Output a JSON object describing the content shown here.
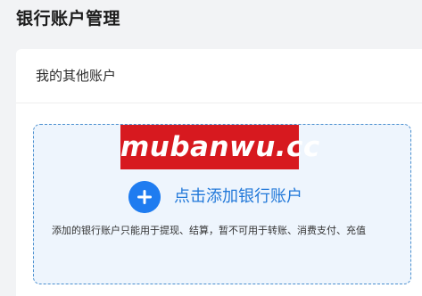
{
  "page": {
    "title": "银行账户管理"
  },
  "card": {
    "header_title": "我的其他账户"
  },
  "add_account": {
    "icon": "plus-icon",
    "label": "点击添加银行账户",
    "note": "添加的银行账户只能用于提现、结算，暂不可用于转账、消费支付、充值"
  },
  "watermark": {
    "text": "mubanwu.cc",
    "background": "#d7191f"
  },
  "colors": {
    "accent": "#1f7cf0",
    "link_text": "#2178d9",
    "dashed_border": "#4a8fcf",
    "box_background": "#eef5fd"
  }
}
